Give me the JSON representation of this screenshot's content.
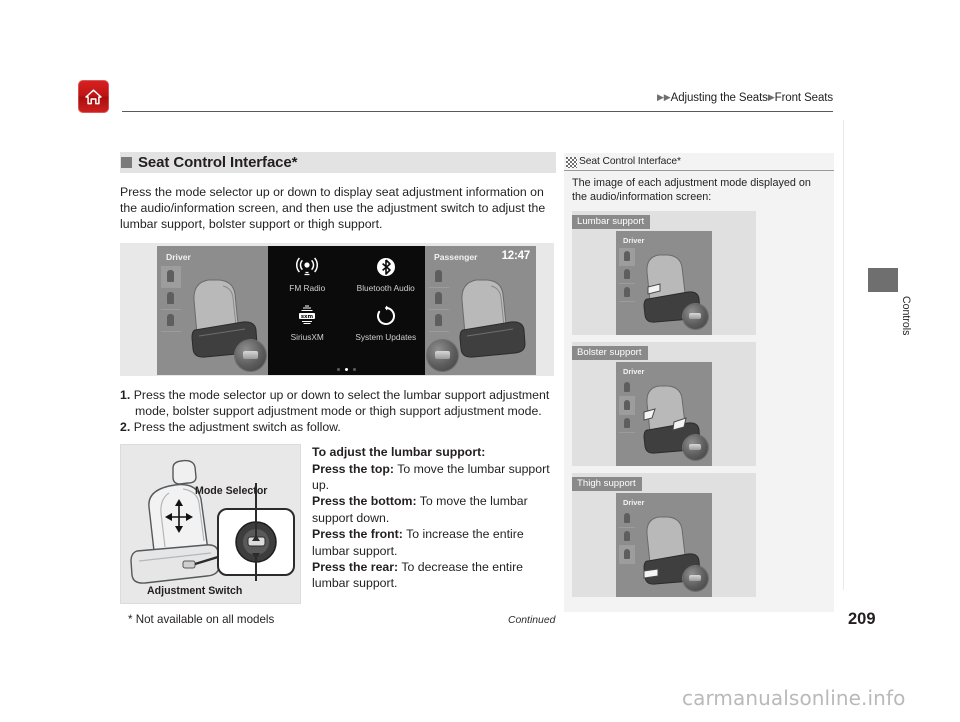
{
  "header": {
    "home_icon": "home-icon",
    "breadcrumb": {
      "arrow": "▶",
      "level1": "Adjusting the Seats",
      "level2": "Front Seats"
    }
  },
  "main": {
    "heading": "Seat Control Interface*",
    "intro": "Press the mode selector up or down to display seat adjustment information on the audio/information screen, and then use the adjustment switch to adjust the lumbar support, bolster support or thigh support.",
    "screen_figure": {
      "driver_label": "Driver",
      "passenger_label": "Passenger",
      "clock": "12:47",
      "apps": [
        {
          "label": "FM Radio",
          "icon": "fm-radio-icon"
        },
        {
          "label": "Bluetooth Audio",
          "icon": "bluetooth-icon"
        },
        {
          "label": "SiriusXM",
          "icon": "siriusxm-icon"
        },
        {
          "label": "System Updates",
          "icon": "system-updates-icon"
        }
      ]
    },
    "steps": [
      {
        "num": "1.",
        "text": "Press the mode selector up or down to select the lumbar support adjustment mode, bolster support adjustment mode or thigh support adjustment mode."
      },
      {
        "num": "2.",
        "text": "Press the adjustment switch as follow."
      }
    ],
    "seat_figure": {
      "mode_selector_label": "Mode Selector",
      "adjustment_switch_label": "Adjustment Switch"
    },
    "lumbar": {
      "title": "To adjust the lumbar support:",
      "items": [
        {
          "label": "Press the top:",
          "text": " To move the lumbar support up."
        },
        {
          "label": "Press the bottom:",
          "text": " To move the lumbar support down."
        },
        {
          "label": "Press the front:",
          "text": " To increase the entire lumbar support."
        },
        {
          "label": "Press the rear:",
          "text": " To decrease the entire lumbar support."
        }
      ]
    }
  },
  "sidebar": {
    "icon": "hatched-square-icon",
    "title": "Seat Control Interface*",
    "description": "The image of each adjustment mode displayed on the audio/information screen:",
    "panels": [
      {
        "caption": "Lumbar support",
        "driver_label": "Driver",
        "active_mode": 0
      },
      {
        "caption": "Bolster support",
        "driver_label": "Driver",
        "active_mode": 1
      },
      {
        "caption": "Thigh support",
        "driver_label": "Driver",
        "active_mode": 2
      }
    ]
  },
  "side_tab": {
    "label": "Controls"
  },
  "footer": {
    "footnote": "* Not available on all models",
    "continued": "Continued",
    "page_number": "209"
  },
  "watermark": "carmanualsonline.info"
}
